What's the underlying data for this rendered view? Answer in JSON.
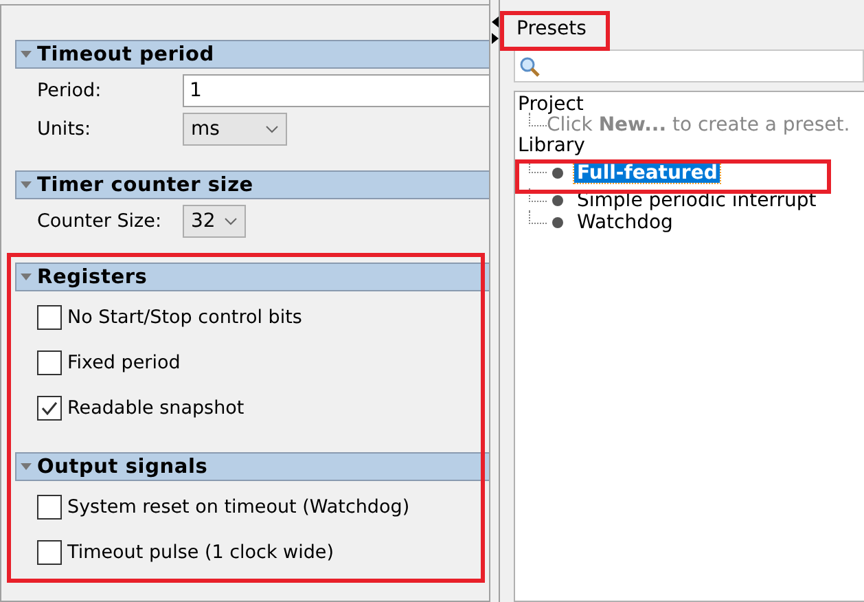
{
  "left_panel": {
    "sections": [
      {
        "title": "Timeout period",
        "expanded": true,
        "rows": [
          {
            "kind": "text",
            "label": "Period:",
            "value": "1"
          },
          {
            "kind": "select",
            "label": "Units:",
            "value": "ms"
          }
        ]
      },
      {
        "title": "Timer counter size",
        "expanded": true,
        "rows": [
          {
            "kind": "select",
            "label": "Counter Size:",
            "value": "32"
          }
        ]
      },
      {
        "title": "Registers",
        "expanded": true,
        "rows": [
          {
            "kind": "checkbox",
            "label": "No Start/Stop control bits",
            "checked": false
          },
          {
            "kind": "checkbox",
            "label": "Fixed period",
            "checked": false
          },
          {
            "kind": "checkbox",
            "label": "Readable snapshot",
            "checked": true
          }
        ]
      },
      {
        "title": "Output signals",
        "expanded": true,
        "rows": [
          {
            "kind": "checkbox",
            "label": "System reset on timeout (Watchdog)",
            "checked": false
          },
          {
            "kind": "checkbox",
            "label": "Timeout pulse (1 clock wide)",
            "checked": false
          }
        ]
      }
    ]
  },
  "presets": {
    "title": "Presets",
    "tree": [
      {
        "label": "Project",
        "children": [
          {
            "kind": "hint",
            "label": "Click **New...** to create a preset."
          }
        ]
      },
      {
        "label": "Library",
        "children": [
          {
            "kind": "preset",
            "label": "Full-featured",
            "selected": true
          },
          {
            "kind": "preset",
            "label": "Simple periodic interrupt",
            "selected": false
          },
          {
            "kind": "preset",
            "label": "Watchdog",
            "selected": false
          }
        ]
      }
    ]
  }
}
